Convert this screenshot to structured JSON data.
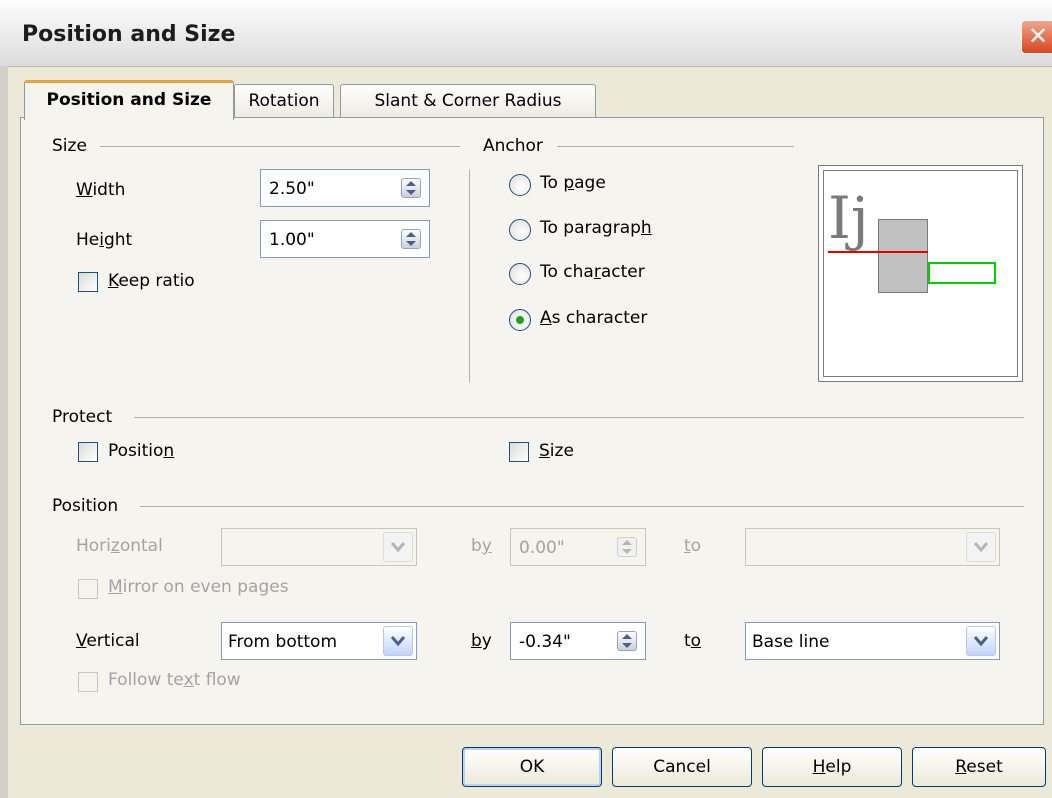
{
  "dialog": {
    "title": "Position and Size",
    "close": "✕"
  },
  "tabs": [
    "Position and Size",
    "Rotation",
    "Slant & Corner Radius"
  ],
  "size": {
    "heading": "Size",
    "width": {
      "pre": "",
      "acc": "W",
      "post": "idth",
      "value": "2.50\""
    },
    "height": {
      "pre": "He",
      "acc": "i",
      "post": "ght",
      "value": "1.00\""
    },
    "keep_ratio": {
      "pre": "",
      "acc": "K",
      "post": "eep ratio",
      "checked": false
    }
  },
  "anchor": {
    "heading": "Anchor",
    "options": [
      {
        "pre": "To ",
        "acc": "p",
        "post": "age",
        "selected": false
      },
      {
        "pre": "To paragrap",
        "acc": "h",
        "post": "",
        "selected": false
      },
      {
        "pre": "To cha",
        "acc": "r",
        "post": "acter",
        "selected": false
      },
      {
        "pre": "",
        "acc": "A",
        "post": "s character",
        "selected": true
      }
    ],
    "preview_text": "Ij"
  },
  "protect": {
    "heading": "Protect",
    "position": {
      "pre": "Positio",
      "acc": "n",
      "post": "",
      "checked": false
    },
    "size": {
      "pre": "",
      "acc": "S",
      "post": "ize",
      "checked": false
    }
  },
  "position": {
    "heading": "Position",
    "horizontal": {
      "label": {
        "pre": "Hori",
        "acc": "z",
        "post": "ontal"
      },
      "value": "",
      "by_label": {
        "pre": "b",
        "acc": "y",
        "post": ""
      },
      "by_value": "0.00\"",
      "to_label": {
        "pre": "",
        "acc": "t",
        "post": "o"
      },
      "to_value": ""
    },
    "mirror": {
      "pre": "",
      "acc": "M",
      "post": "irror on even pages"
    },
    "vertical": {
      "label": {
        "pre": "",
        "acc": "V",
        "post": "ertical"
      },
      "value": "From bottom",
      "by_label": {
        "pre": "",
        "acc": "b",
        "post": "y"
      },
      "by_value": "-0.34\"",
      "to_label": {
        "pre": "t",
        "acc": "o",
        "post": ""
      },
      "to_value": "Base line"
    },
    "follow": {
      "pre": "Follow te",
      "acc": "x",
      "post": "t flow"
    }
  },
  "buttons": {
    "ok": {
      "pre": "OK",
      "acc": "",
      "post": ""
    },
    "cancel": {
      "pre": "Cancel",
      "acc": "",
      "post": ""
    },
    "help": {
      "pre": "",
      "acc": "H",
      "post": "elp"
    },
    "reset": {
      "pre": "",
      "acc": "R",
      "post": "eset"
    }
  },
  "colors": {
    "accent_tab": "#e5a53c",
    "radio_dot": "#21a121",
    "baseline": "#e00000",
    "frame": "#00d000"
  }
}
